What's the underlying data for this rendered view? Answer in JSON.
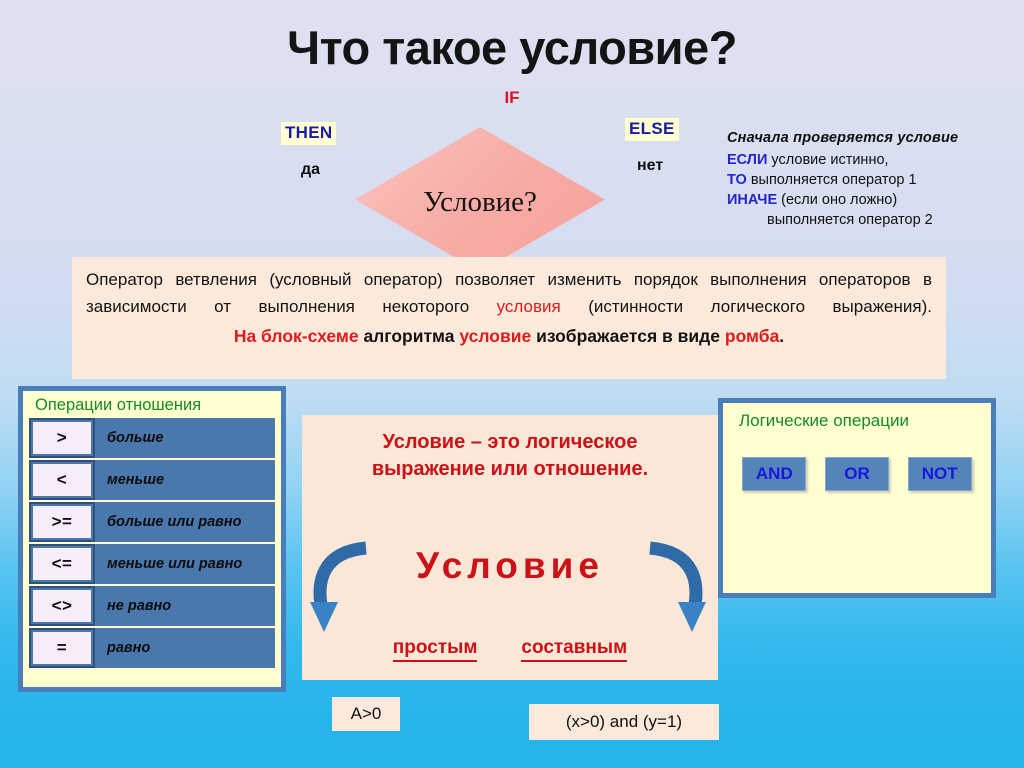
{
  "slide": {
    "title": "Что такое условие?",
    "if_label": "IF"
  },
  "flowchart": {
    "diamond_label": "Условие?",
    "then_label": "THEN",
    "else_label": "ELSE",
    "yes_label": "да",
    "no_label": "нет"
  },
  "explanation": {
    "line1": "Сначала проверяется условие",
    "kw_if": "ЕСЛИ",
    "line2": "условие истинно,",
    "kw_then": "ТО",
    "line3": "выполняется оператор 1",
    "kw_else": "ИНАЧЕ",
    "line4": "(если оно ложно)",
    "line5": "выполняется оператор 2"
  },
  "paragraph": {
    "p1_a": "Оператор ветвления (условный оператор) позволяет изменить порядок выполнения операторов в зависимости от выполнения некоторого ",
    "p1_red": "условия",
    "p1_b": " (истинности логического выражения).",
    "p2_red1": "На блок-схеме",
    "p2_mid1": " алгоритма ",
    "p2_red2": "условие",
    "p2_mid2": " изображается в виде ",
    "p2_red3": "ромба",
    "p2_end": "."
  },
  "relations": {
    "title": "Операции отношения",
    "rows": [
      {
        "op": ">",
        "meaning": "больше"
      },
      {
        "op": "<",
        "meaning": "меньше"
      },
      {
        "op": ">=",
        "meaning": "больше или равно"
      },
      {
        "op": "<=",
        "meaning": "меньше или равно"
      },
      {
        "op": "<>",
        "meaning": "не равно"
      },
      {
        "op": "=",
        "meaning": "равно"
      }
    ]
  },
  "center": {
    "heading_line1": "Условие – это логическое",
    "heading_line2": "выражение или отношение.",
    "big_word": "Условие",
    "option_simple": "простым",
    "option_compound": "составным"
  },
  "logic": {
    "title": "Логические операции",
    "operations": [
      "AND",
      "OR",
      "NOT"
    ]
  },
  "examples": {
    "simple": "A>0",
    "compound": "(x>0) and (y=1)"
  },
  "colors": {
    "red_accent": "#cc1216",
    "blue_accent": "#2525cf",
    "green_heading": "#158a2a",
    "panel_border": "#4a7ebb",
    "table_cell": "#4a78ad",
    "diamond": "#f7aaa4",
    "paragraph_bg": "#fbeadb"
  }
}
